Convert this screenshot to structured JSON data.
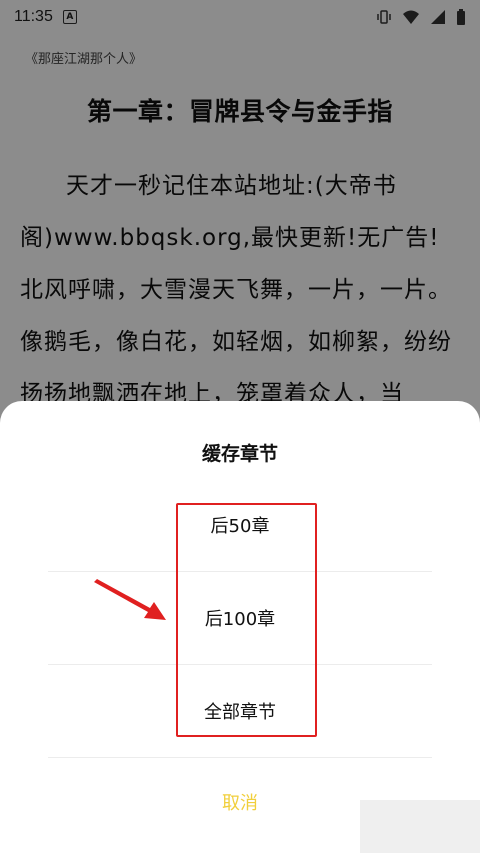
{
  "status_bar": {
    "time": "11:35",
    "notification_letter": "A",
    "icons": [
      "vibrate-icon",
      "wifi-icon",
      "signal-icon",
      "battery-icon"
    ]
  },
  "reader": {
    "book_title": "《那座江湖那个人》",
    "chapter_title": "第一章：冒牌县令与金手指",
    "body_text": "天才一秒记住本站地址:(大帝书阁)www.bbqsk.org,最快更新!无广告! 北风呼啸，大雪漫天飞舞，一片，一片。像鹅毛，像白花，如轻烟，如柳絮，纷纷扬扬地飘洒在地上，笼罩着众人，当"
  },
  "sheet": {
    "title": "缓存章节",
    "options": [
      "后50章",
      "后100章",
      "全部章节"
    ],
    "cancel_label": "取消"
  },
  "colors": {
    "cancel": "#f1cf3c",
    "highlight": "#e02020"
  }
}
